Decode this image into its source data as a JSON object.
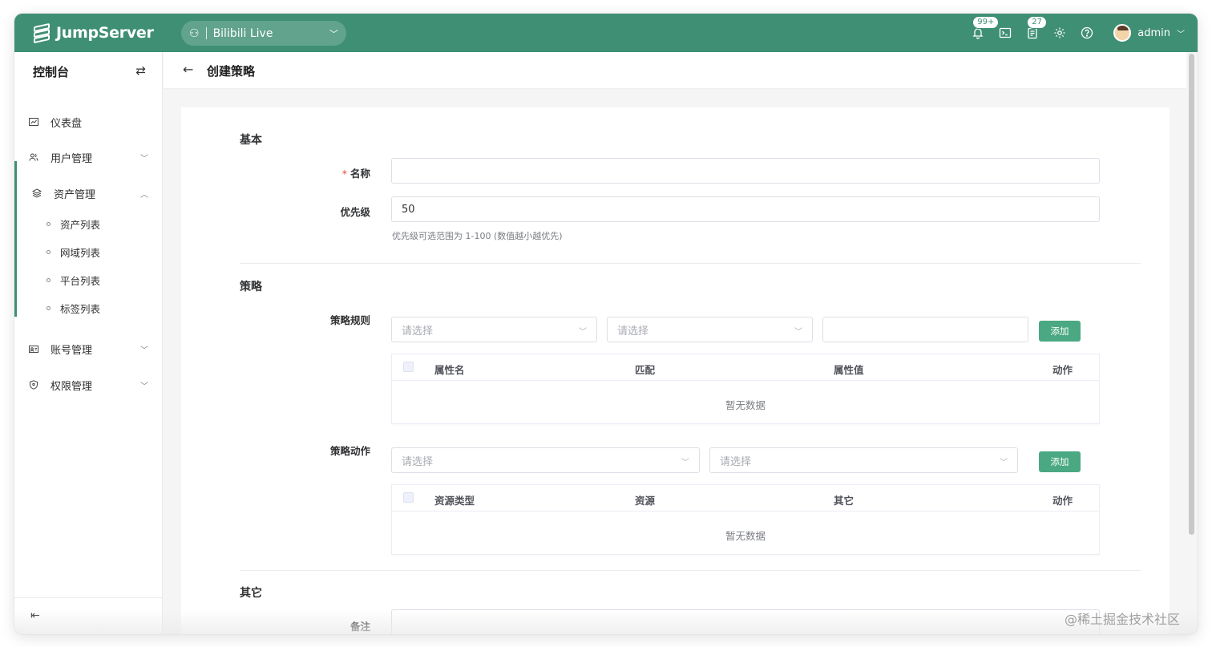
{
  "app": {
    "brand": "JumpServer"
  },
  "org": {
    "name": "Bilibili Live"
  },
  "topbar": {
    "notifications_badge": "99+",
    "tickets_badge": "27",
    "user_name": "admin"
  },
  "sidebar": {
    "title": "控制台",
    "items": [
      {
        "label": "仪表盘"
      },
      {
        "label": "用户管理"
      },
      {
        "label": "资产管理"
      },
      {
        "label": "账号管理"
      },
      {
        "label": "权限管理"
      }
    ],
    "sub_items": [
      {
        "label": "资产列表"
      },
      {
        "label": "网域列表"
      },
      {
        "label": "平台列表"
      },
      {
        "label": "标签列表"
      }
    ]
  },
  "page": {
    "title": "创建策略"
  },
  "form": {
    "basic": {
      "section_title": "基本",
      "name_label": "名称",
      "name_value": "",
      "priority_label": "优先级",
      "priority_value": "50",
      "priority_hint": "优先级可选范围为 1-100 (数值越小越优先)"
    },
    "strategy": {
      "section_title": "策略",
      "rules_label": "策略规则",
      "rules_select1_placeholder": "请选择",
      "rules_select2_placeholder": "请选择",
      "rules_value_input": "",
      "add_label": "添加",
      "rules_table": {
        "columns": [
          "属性名",
          "匹配",
          "属性值",
          "动作"
        ],
        "empty_text": "暂无数据"
      },
      "actions_label": "策略动作",
      "actions_select1_placeholder": "请选择",
      "actions_select2_placeholder": "请选择",
      "actions_table": {
        "columns": [
          "资源类型",
          "资源",
          "其它",
          "动作"
        ],
        "empty_text": "暂无数据"
      }
    },
    "other": {
      "section_title": "其它",
      "comment_label": "备注"
    }
  },
  "watermark": "@稀土掘金技术社区"
}
